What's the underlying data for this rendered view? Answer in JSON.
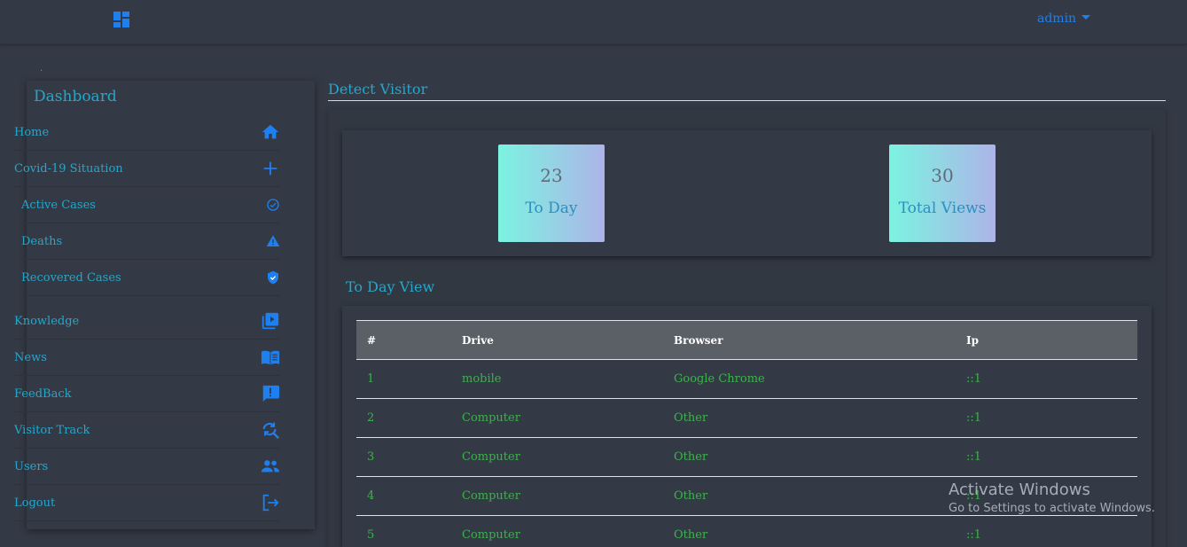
{
  "topbar": {
    "user_label": "admin",
    "logo_icon": "dashboard-grid-icon"
  },
  "sidebar": {
    "title": "Dashboard",
    "items": [
      {
        "label": "Home",
        "icon": "home-icon"
      },
      {
        "label": "Covid-19 Situation",
        "icon": "plus-icon"
      },
      {
        "label": "Active Cases",
        "icon": "check-circle-icon"
      },
      {
        "label": "Deaths",
        "icon": "warning-icon"
      },
      {
        "label": "Recovered Cases",
        "icon": "shield-check-icon"
      },
      {
        "label": "Knowledge",
        "icon": "video-library-icon"
      },
      {
        "label": "News",
        "icon": "book-icon"
      },
      {
        "label": "FeedBack",
        "icon": "feedback-icon"
      },
      {
        "label": "Visitor Track",
        "icon": "search-refresh-icon"
      },
      {
        "label": "Users",
        "icon": "people-icon"
      },
      {
        "label": "Logout",
        "icon": "logout-icon"
      }
    ]
  },
  "main": {
    "title": "Detect Visitor",
    "stats": [
      {
        "value": "23",
        "label": "To Day"
      },
      {
        "value": "30",
        "label": "Total Views"
      }
    ],
    "table_title": "To Day View",
    "table": {
      "headers": [
        "#",
        "Drive",
        "Browser",
        "Ip"
      ],
      "rows": [
        [
          "1",
          "mobile",
          "Google Chrome",
          "::1"
        ],
        [
          "2",
          "Computer",
          "Other",
          "::1"
        ],
        [
          "3",
          "Computer",
          "Other",
          "::1"
        ],
        [
          "4",
          "Computer",
          "Other",
          "::1"
        ],
        [
          "5",
          "Computer",
          "Other",
          "::1"
        ]
      ]
    }
  },
  "watermark": {
    "line1": "Activate Windows",
    "line2": "Go to Settings to activate Windows."
  },
  "colors": {
    "accent": "#24a7cc",
    "link_blue": "#1e7ff0",
    "row_text": "#3bb24a",
    "background": "#343a45"
  }
}
